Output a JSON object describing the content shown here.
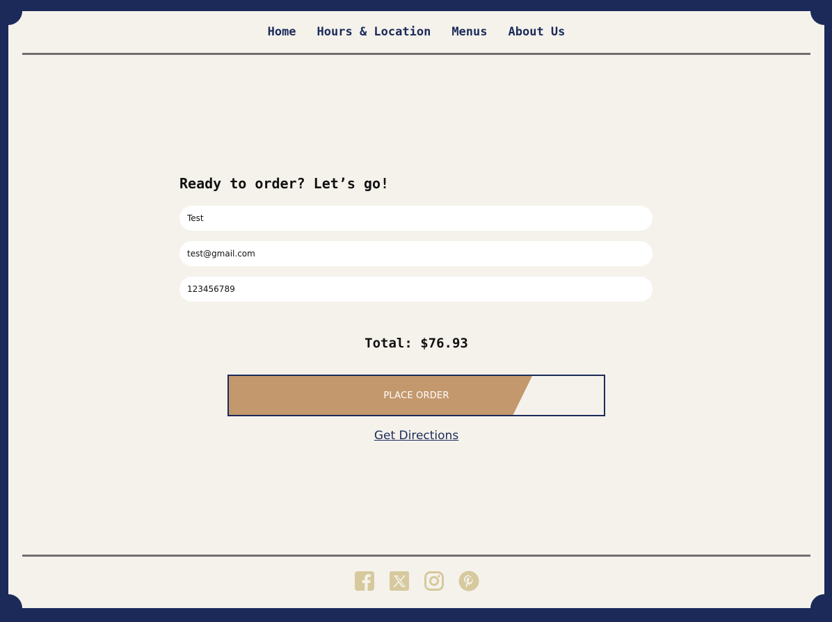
{
  "nav": {
    "items": [
      {
        "label": "Home"
      },
      {
        "label": "Hours & Location"
      },
      {
        "label": "Menus"
      },
      {
        "label": "About Us"
      }
    ]
  },
  "form": {
    "title": "Ready to order? Let’s go!",
    "name_value": "Test",
    "email_value": "test@gmail.com",
    "phone_value": "123456789"
  },
  "order": {
    "total_label": "Total: $76.93",
    "button_label": "PLACE ORDER",
    "directions_label": "Get Directions"
  },
  "social": {
    "icons": [
      "facebook-icon",
      "x-twitter-icon",
      "instagram-icon",
      "pinterest-icon"
    ]
  },
  "colors": {
    "navy": "#1b2a59",
    "page_bg": "#f5f2ec",
    "button_fill": "#c4986d",
    "social_icon": "#d6c99d",
    "rule": "#6e6e6e"
  }
}
